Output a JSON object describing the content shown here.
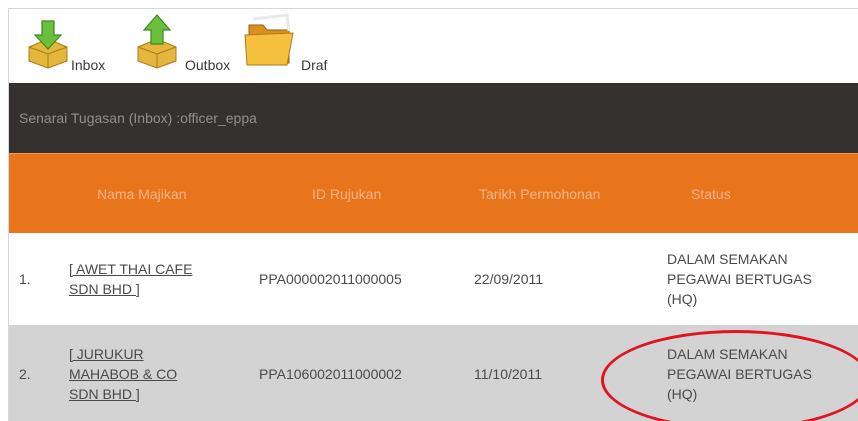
{
  "toolbar": {
    "inbox_label": "Inbox",
    "outbox_label": "Outbox",
    "draf_label": "Draf"
  },
  "title": "Senarai Tugasan (Inbox) :officer_eppa",
  "table": {
    "headers": [
      "Nama Majikan",
      "ID Rujukan",
      "Tarikh Permohonan",
      "Status"
    ],
    "rows": [
      {
        "no": "1.",
        "name_line1": "[ AWET THAI CAFE",
        "name_line2": "SDN BHD ]",
        "name_line3": "",
        "id": "PPA000002011000005",
        "date": "22/09/2011",
        "status_line1": "DALAM SEMAKAN",
        "status_line2": "PEGAWAI BERTUGAS",
        "status_line3": "(HQ)"
      },
      {
        "no": "2.",
        "name_line1": "[ JURUKUR",
        "name_line2": "MAHABOB & CO",
        "name_line3": "SDN BHD ]",
        "id": "PPA106002011000002",
        "date": "11/10/2011",
        "status_line1": "DALAM SEMAKAN",
        "status_line2": "PEGAWAI BERTUGAS",
        "status_line3": "(HQ)"
      }
    ]
  },
  "colors": {
    "header_bg": "#e8741b",
    "titlebar_bg": "#353131",
    "highlight_circle": "#e0141e"
  },
  "icons": {
    "inbox": "box-with-down-arrow-icon",
    "outbox": "box-with-up-arrow-icon",
    "draf": "folder-icon"
  }
}
